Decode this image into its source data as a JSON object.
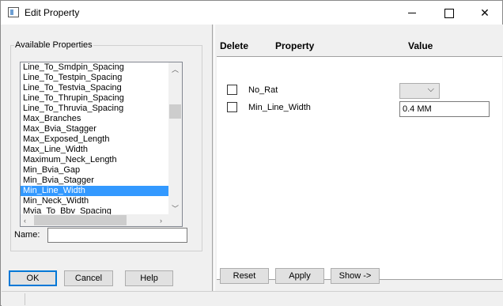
{
  "window": {
    "title": "Edit Property"
  },
  "left": {
    "group_label": "Available Properties",
    "list_items": [
      "Line_To_Smdpin_Spacing",
      "Line_To_Testpin_Spacing",
      "Line_To_Testvia_Spacing",
      "Line_To_Thrupin_Spacing",
      "Line_To_Thruvia_Spacing",
      "Max_Branches",
      "Max_Bvia_Stagger",
      "Max_Exposed_Length",
      "Max_Line_Width",
      "Maximum_Neck_Length",
      "Min_Bvia_Gap",
      "Min_Bvia_Stagger",
      "Min_Line_Width",
      "Min_Neck_Width",
      "Mvia_To_Bbv_Spacing"
    ],
    "selected_item": "Min_Line_Width",
    "name_label": "Name:",
    "name_value": ""
  },
  "buttons": {
    "ok": "OK",
    "cancel": "Cancel",
    "help": "Help",
    "reset": "Reset",
    "apply": "Apply",
    "show": "Show ->"
  },
  "right": {
    "headers": {
      "delete": "Delete",
      "property": "Property",
      "value": "Value"
    },
    "rows": [
      {
        "property": "No_Rat",
        "value": "",
        "control": "dropdown",
        "delete_checked": false
      },
      {
        "property": "Min_Line_Width",
        "value": "0.4 MM",
        "control": "text",
        "delete_checked": false
      }
    ]
  },
  "colors": {
    "selection": "#3399ff",
    "default_button_border": "#0078d7"
  }
}
